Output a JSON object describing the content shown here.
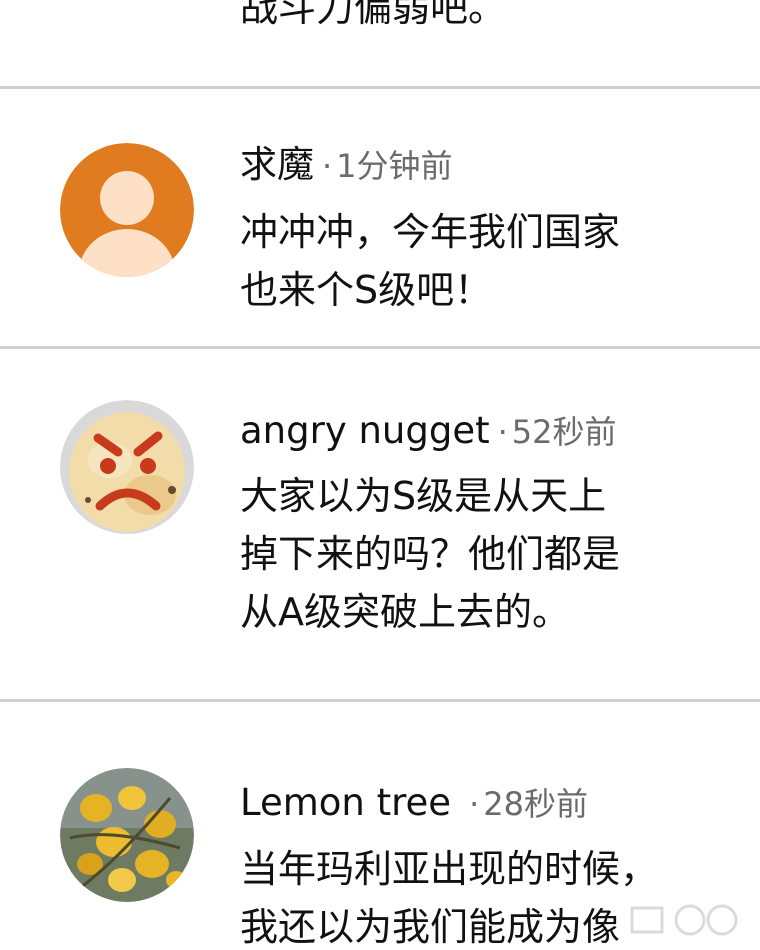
{
  "top_fragment": "战斗力偏弱吧。",
  "comments": [
    {
      "name": "求魔",
      "time": "1分钟前",
      "lines": [
        "冲冲冲，今年我们国家",
        "也来个S级吧！"
      ]
    },
    {
      "name": "angry nugget",
      "time": "52秒前",
      "lines": [
        "大家以为S级是从天上",
        "掉下来的吗？他们都是",
        "从A级突破上去的。"
      ]
    },
    {
      "name": "Lemon tree",
      "time": "28秒前",
      "lines": [
        "当年玛利亚出现的时候，",
        "我还以为我们能成为像"
      ]
    }
  ],
  "meta_separator": "·",
  "colors": {
    "divider": "#d0d0d0",
    "time_text": "#6b6b6b",
    "default_avatar_bg": "#e07c1f",
    "default_avatar_figure": "#fde0c6"
  },
  "icons": {
    "avatar_1": "default-user-avatar-icon",
    "avatar_2": "angry-nugget-avatar",
    "avatar_3": "lemon-tree-avatar"
  }
}
